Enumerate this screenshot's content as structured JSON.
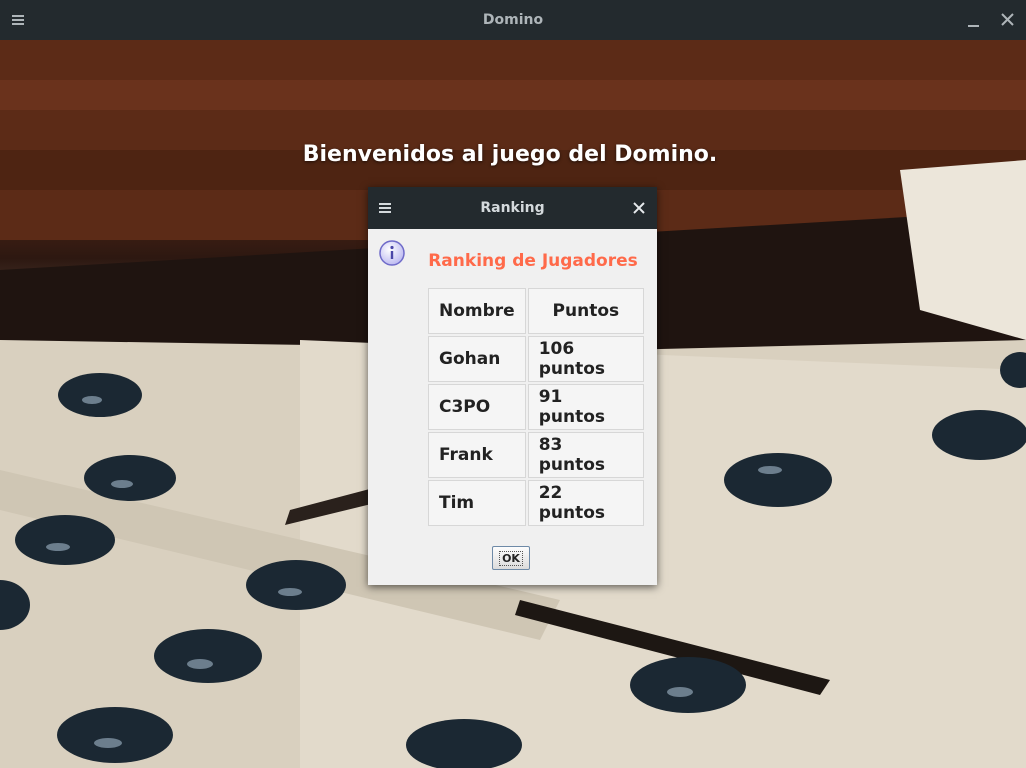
{
  "window": {
    "title": "Domino"
  },
  "main": {
    "welcome_text": "Bienvenidos al juego del Domino."
  },
  "dialog": {
    "title": "Ranking",
    "heading": "Ranking de Jugadores",
    "columns": [
      "Nombre",
      "Puntos"
    ],
    "rows": [
      {
        "name": "Gohan",
        "points": "106 puntos"
      },
      {
        "name": "C3PO",
        "points": "91 puntos"
      },
      {
        "name": "Frank",
        "points": "83 puntos"
      },
      {
        "name": "Tim",
        "points": "22 puntos"
      }
    ],
    "ok_label": "OK"
  },
  "icons": {
    "window_menu": "hamburger-icon",
    "minimize": "minimize-icon",
    "close": "close-icon",
    "info": "info-icon"
  },
  "colors": {
    "titlebar": "#232a2e",
    "heading": "#ff6a4a",
    "dialog_bg": "#f0f0f0"
  }
}
